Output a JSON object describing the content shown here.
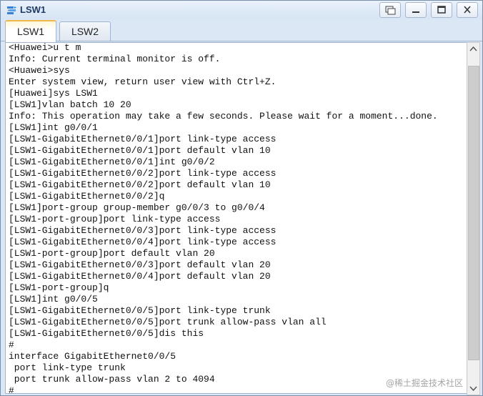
{
  "window": {
    "title": "LSW1",
    "icon": "switch-app-icon",
    "controls": [
      "restore-icon",
      "minimize-icon",
      "maximize-icon",
      "close-icon"
    ]
  },
  "tabs": [
    {
      "label": "LSW1",
      "active": true
    },
    {
      "label": "LSW2",
      "active": false
    }
  ],
  "terminal": {
    "lines": [
      "<Huawei>u t m",
      "Info: Current terminal monitor is off.",
      "<Huawei>sys",
      "Enter system view, return user view with Ctrl+Z.",
      "[Huawei]sys LSW1",
      "[LSW1]vlan batch 10 20",
      "Info: This operation may take a few seconds. Please wait for a moment...done.",
      "[LSW1]int g0/0/1",
      "[LSW1-GigabitEthernet0/0/1]port link-type access",
      "[LSW1-GigabitEthernet0/0/1]port default vlan 10",
      "[LSW1-GigabitEthernet0/0/1]int g0/0/2",
      "[LSW1-GigabitEthernet0/0/2]port link-type access",
      "[LSW1-GigabitEthernet0/0/2]port default vlan 10",
      "[LSW1-GigabitEthernet0/0/2]q",
      "[LSW1]port-group group-member g0/0/3 to g0/0/4",
      "[LSW1-port-group]port link-type access",
      "[LSW1-GigabitEthernet0/0/3]port link-type access",
      "[LSW1-GigabitEthernet0/0/4]port link-type access",
      "[LSW1-port-group]port default vlan 20",
      "[LSW1-GigabitEthernet0/0/3]port default vlan 20",
      "[LSW1-GigabitEthernet0/0/4]port default vlan 20",
      "[LSW1-port-group]q",
      "[LSW1]int g0/0/5",
      "[LSW1-GigabitEthernet0/0/5]port link-type trunk",
      "[LSW1-GigabitEthernet0/0/5]port trunk allow-pass vlan all",
      "[LSW1-GigabitEthernet0/0/5]dis this",
      "#",
      "interface GigabitEthernet0/0/5",
      " port link-type trunk",
      " port trunk allow-pass vlan 2 to 4094",
      "#"
    ]
  },
  "watermark": "@稀土掘金技术社区"
}
